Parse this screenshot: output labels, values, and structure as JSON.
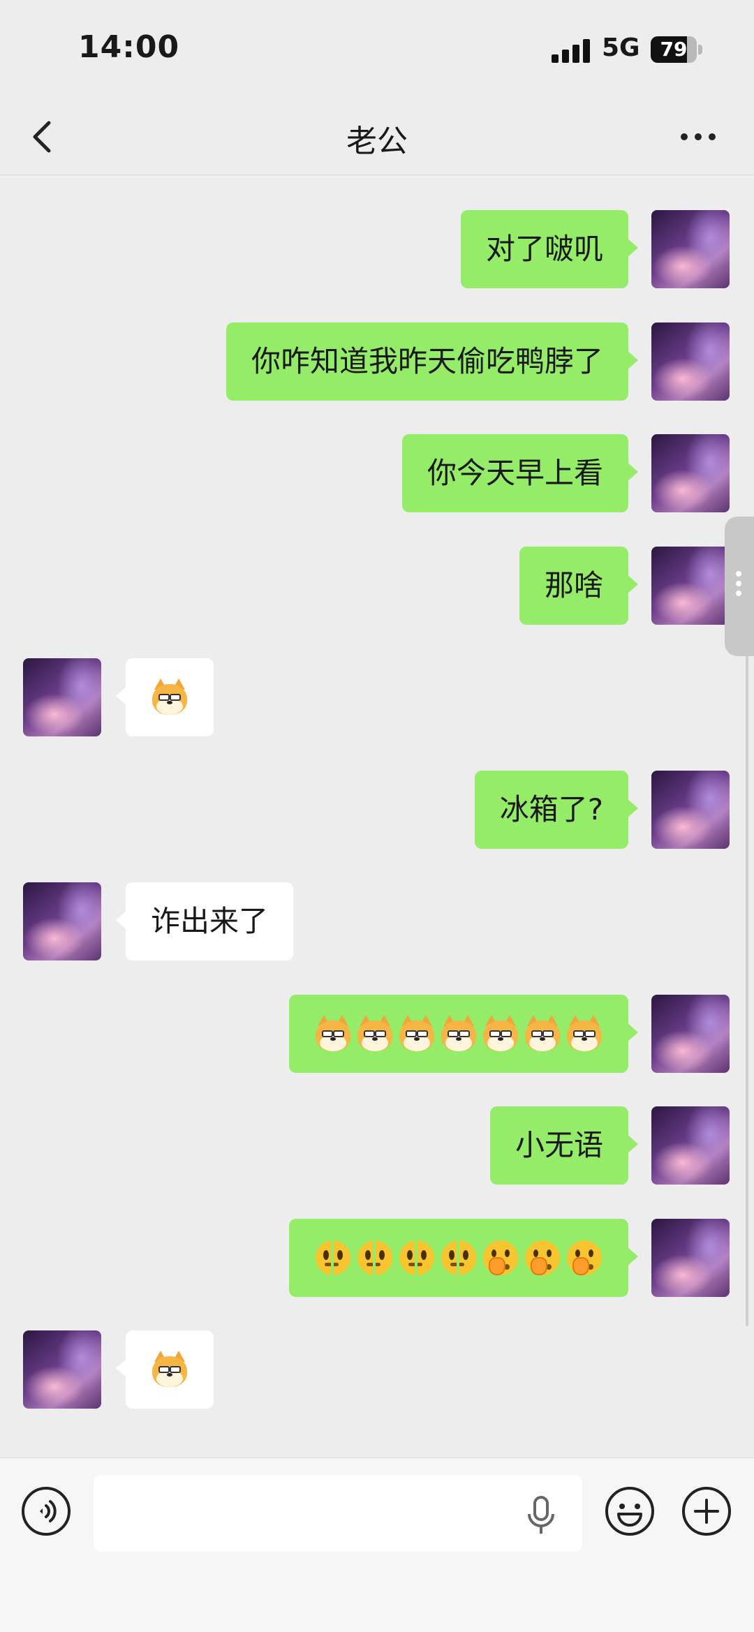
{
  "status_bar": {
    "time": "14:00",
    "network": "5G",
    "battery": "79",
    "battery_level": 0.79
  },
  "header": {
    "title": "老公"
  },
  "messages": [
    {
      "sender": "me",
      "text": "对了啵叽"
    },
    {
      "sender": "me",
      "text": "你咋知道我昨天偷吃鸭脖了"
    },
    {
      "sender": "me",
      "text": "你今天早上看"
    },
    {
      "sender": "me",
      "text": "那啥"
    },
    {
      "sender": "other",
      "emoji": [
        "doge"
      ]
    },
    {
      "sender": "me",
      "text": "冰箱了?"
    },
    {
      "sender": "other",
      "text": "诈出来了"
    },
    {
      "sender": "me",
      "emoji": [
        "doge",
        "doge",
        "doge",
        "doge",
        "doge",
        "doge",
        "doge"
      ]
    },
    {
      "sender": "me",
      "text": "小无语"
    },
    {
      "sender": "me",
      "emoji": [
        "melting-face",
        "melting-face",
        "melting-face",
        "melting-face",
        "shushing-face",
        "shushing-face",
        "shushing-face"
      ]
    },
    {
      "sender": "other",
      "emoji": [
        "doge"
      ]
    }
  ],
  "input_bar": {
    "placeholder": ""
  },
  "icons": {
    "back": "chevron-left-icon",
    "more": "more-dots-icon",
    "voice": "voice-icon",
    "mic": "microphone-icon",
    "emoji": "emoji-icon",
    "plus": "plus-icon"
  },
  "colors": {
    "my_bubble": "#95ec69",
    "other_bubble": "#ffffff",
    "background": "#ededed"
  }
}
